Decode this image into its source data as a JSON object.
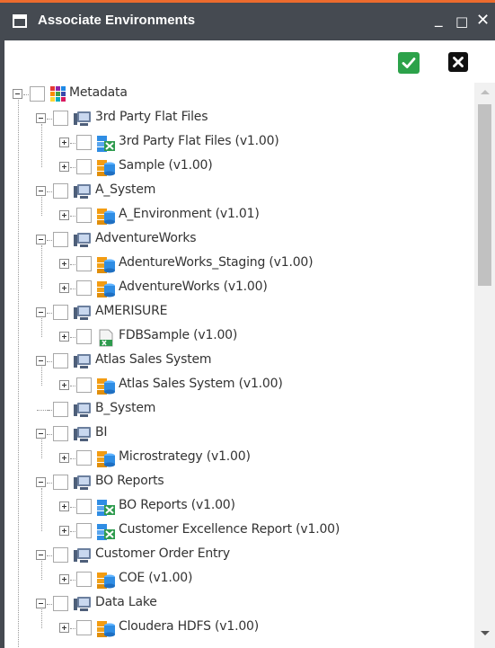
{
  "window": {
    "title": "Associate Environments",
    "minimize_glyph": "_",
    "maximize_glyph": "□",
    "close_glyph": "✕",
    "accent_color": "#ec6b2d",
    "titlebar_color": "#454a51"
  },
  "actions": {
    "confirm_icon": "check-icon",
    "confirm_color": "#2ca24a",
    "cancel_icon": "close-icon",
    "cancel_color": "#111111"
  },
  "tree": {
    "nodes": [
      {
        "label": "Metadata",
        "level": 0,
        "icon": "grid-icon",
        "expander": "minus",
        "checked": false
      },
      {
        "label": "3rd Party Flat Files",
        "level": 1,
        "icon": "system-icon",
        "expander": "minus",
        "checked": false
      },
      {
        "label": "3rd Party Flat Files (v1.00)",
        "level": 2,
        "icon": "flat-file-env-icon",
        "expander": "plus",
        "checked": false
      },
      {
        "label": "Sample (v1.00)",
        "level": 2,
        "icon": "database-env-icon",
        "expander": "plus",
        "checked": false
      },
      {
        "label": "A_System",
        "level": 1,
        "icon": "system-icon",
        "expander": "minus",
        "checked": false
      },
      {
        "label": "A_Environment (v1.01)",
        "level": 2,
        "icon": "database-env-icon",
        "expander": "plus",
        "checked": false
      },
      {
        "label": "AdventureWorks",
        "level": 1,
        "icon": "system-icon",
        "expander": "minus",
        "checked": false
      },
      {
        "label": "AdentureWorks_Staging (v1.00)",
        "level": 2,
        "icon": "database-env-icon",
        "expander": "plus",
        "checked": false
      },
      {
        "label": "AdventureWorks (v1.00)",
        "level": 2,
        "icon": "database-env-icon",
        "expander": "plus",
        "checked": false
      },
      {
        "label": "AMERISURE",
        "level": 1,
        "icon": "system-icon",
        "expander": "minus",
        "checked": false
      },
      {
        "label": "FDBSample (v1.00)",
        "level": 2,
        "icon": "excel-env-icon",
        "expander": "plus",
        "checked": false
      },
      {
        "label": "Atlas Sales System",
        "level": 1,
        "icon": "system-icon",
        "expander": "minus",
        "checked": false
      },
      {
        "label": "Atlas Sales System (v1.00)",
        "level": 2,
        "icon": "database-env-icon",
        "expander": "plus",
        "checked": false
      },
      {
        "label": "B_System",
        "level": 1,
        "icon": "system-icon",
        "expander": "none",
        "checked": false
      },
      {
        "label": "BI",
        "level": 1,
        "icon": "system-icon",
        "expander": "minus",
        "checked": false
      },
      {
        "label": "Microstrategy (v1.00)",
        "level": 2,
        "icon": "database-env-icon",
        "expander": "plus",
        "checked": false
      },
      {
        "label": "BO Reports",
        "level": 1,
        "icon": "system-icon",
        "expander": "minus",
        "checked": false
      },
      {
        "label": "BO Reports (v1.00)",
        "level": 2,
        "icon": "flat-file-env-icon",
        "expander": "plus",
        "checked": false
      },
      {
        "label": "Customer Excellence Report (v1.00)",
        "level": 2,
        "icon": "flat-file-env-icon",
        "expander": "plus",
        "checked": false
      },
      {
        "label": "Customer Order Entry",
        "level": 1,
        "icon": "system-icon",
        "expander": "minus",
        "checked": false
      },
      {
        "label": "COE (v1.00)",
        "level": 2,
        "icon": "database-env-icon",
        "expander": "plus",
        "checked": false
      },
      {
        "label": "Data Lake",
        "level": 1,
        "icon": "system-icon",
        "expander": "minus",
        "checked": false
      },
      {
        "label": "Cloudera HDFS (v1.00)",
        "level": 2,
        "icon": "database-env-icon",
        "expander": "plus",
        "checked": false
      }
    ]
  },
  "scrollbar": {
    "position_fraction": 0.0,
    "visible_fraction": 0.33
  }
}
